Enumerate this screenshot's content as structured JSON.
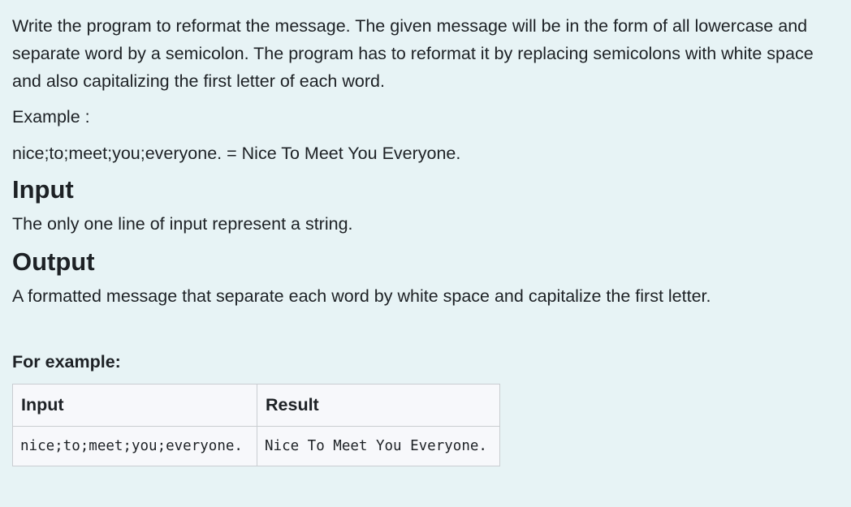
{
  "description": {
    "paragraph": "Write the program to reformat the message. The given message will be in the form of all lowercase and separate word by a semicolon. The program has to reformat it by replacing semicolons with white space and also capitalizing the first letter of each word.",
    "example_label": "Example :",
    "example_line": "nice;to;meet;you;everyone. = Nice To Meet You Everyone."
  },
  "input_section": {
    "heading": "Input",
    "text": "The only one line of input represent a string."
  },
  "output_section": {
    "heading": "Output",
    "text": "A formatted message that separate each word by white space and capitalize the first letter."
  },
  "examples": {
    "label": "For example:",
    "headers": [
      "Input",
      "Result"
    ],
    "rows": [
      {
        "input": "nice;to;meet;you;everyone.",
        "result": "Nice To Meet You Everyone."
      }
    ]
  }
}
